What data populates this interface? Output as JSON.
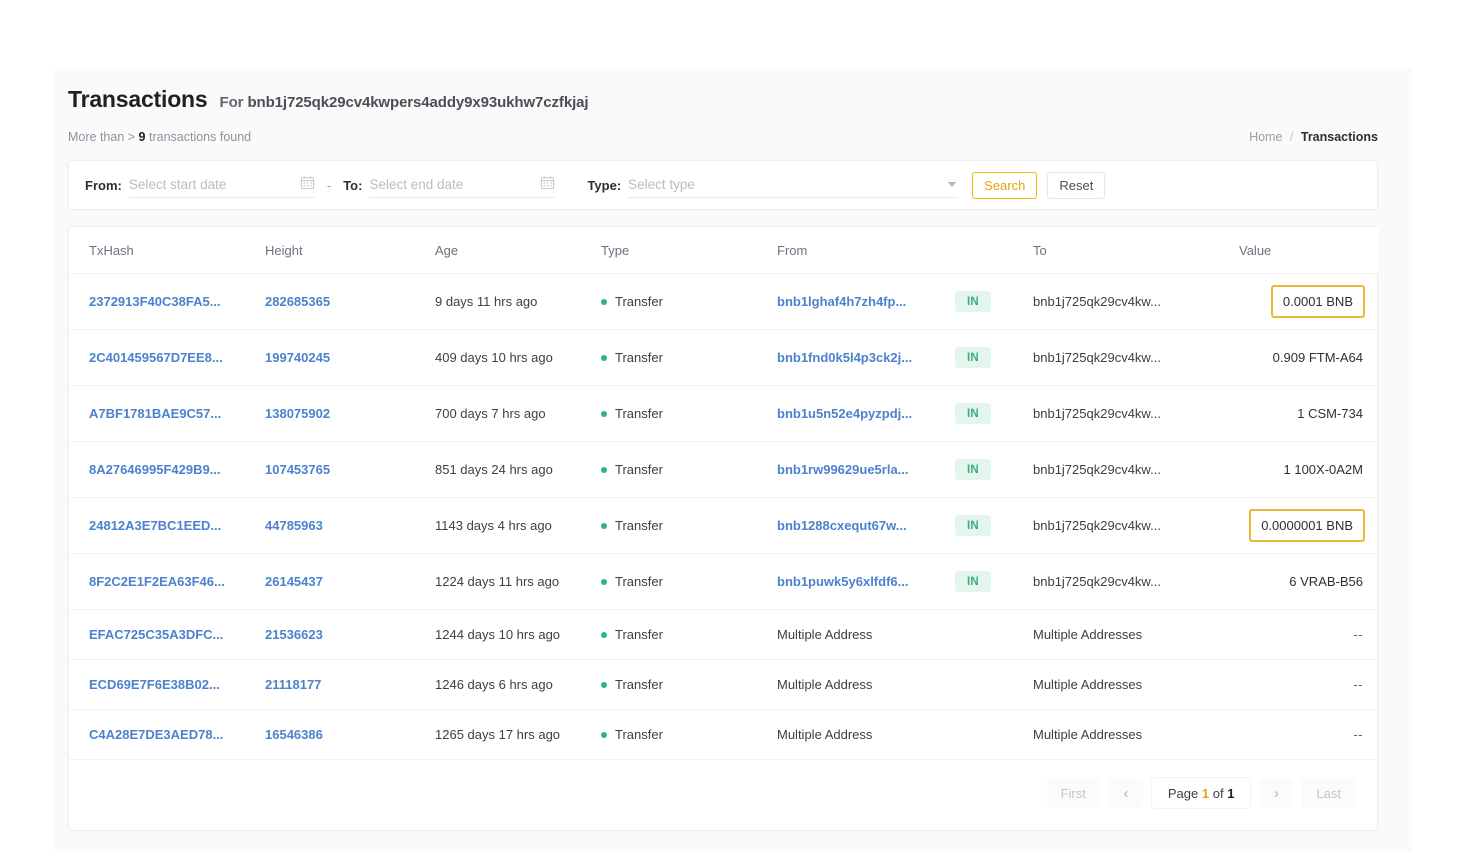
{
  "header": {
    "title": "Transactions",
    "for_label": "For",
    "address": "bnb1j725qk29cv4kwpers4addy9x93ukhw7czfkjaj",
    "found_prefix": "More than >",
    "found_count": "9",
    "found_suffix": "transactions found"
  },
  "breadcrumb": {
    "home": "Home",
    "separator": "/",
    "current": "Transactions"
  },
  "filters": {
    "from_label": "From:",
    "from_placeholder": "Select start date",
    "range_dash": "-",
    "to_label": "To:",
    "to_placeholder": "Select end date",
    "type_label": "Type:",
    "type_placeholder": "Select type",
    "search_button": "Search",
    "reset_button": "Reset",
    "search_accent_color": "#f0b90b"
  },
  "table": {
    "columns": [
      "TxHash",
      "Height",
      "Age",
      "Type",
      "From",
      "To",
      "Value"
    ],
    "rows": [
      {
        "txhash": "2372913F40C38FA5...",
        "height": "282685365",
        "age": "9 days 11 hrs ago",
        "type": "Transfer",
        "from": "bnb1lghaf4h7zh4fp...",
        "from_is_link": true,
        "direction": "IN",
        "to": "bnb1j725qk29cv4kw...",
        "value": "0.0001 BNB",
        "value_highlighted": true
      },
      {
        "txhash": "2C401459567D7EE8...",
        "height": "199740245",
        "age": "409 days 10 hrs ago",
        "type": "Transfer",
        "from": "bnb1fnd0k5l4p3ck2j...",
        "from_is_link": true,
        "direction": "IN",
        "to": "bnb1j725qk29cv4kw...",
        "value": "0.909 FTM-A64",
        "value_highlighted": false
      },
      {
        "txhash": "A7BF1781BAE9C57...",
        "height": "138075902",
        "age": "700 days 7 hrs ago",
        "type": "Transfer",
        "from": "bnb1u5n52e4pyzpdj...",
        "from_is_link": true,
        "direction": "IN",
        "to": "bnb1j725qk29cv4kw...",
        "value": "1 CSM-734",
        "value_highlighted": false
      },
      {
        "txhash": "8A27646995F429B9...",
        "height": "107453765",
        "age": "851 days 24 hrs ago",
        "type": "Transfer",
        "from": "bnb1rw99629ue5rla...",
        "from_is_link": true,
        "direction": "IN",
        "to": "bnb1j725qk29cv4kw...",
        "value": "1 100X-0A2M",
        "value_highlighted": false
      },
      {
        "txhash": "24812A3E7BC1EED...",
        "height": "44785963",
        "age": "1143 days 4 hrs ago",
        "type": "Transfer",
        "from": "bnb1288cxequt67w...",
        "from_is_link": true,
        "direction": "IN",
        "to": "bnb1j725qk29cv4kw...",
        "value": "0.0000001 BNB",
        "value_highlighted": true
      },
      {
        "txhash": "8F2C2E1F2EA63F46...",
        "height": "26145437",
        "age": "1224 days 11 hrs ago",
        "type": "Transfer",
        "from": "bnb1puwk5y6xlfdf6...",
        "from_is_link": true,
        "direction": "IN",
        "to": "bnb1j725qk29cv4kw...",
        "value": "6 VRAB-B56",
        "value_highlighted": false
      },
      {
        "txhash": "EFAC725C35A3DFC...",
        "height": "21536623",
        "age": "1244 days 10 hrs ago",
        "type": "Transfer",
        "from": "Multiple Address",
        "from_is_link": false,
        "direction": "",
        "to": "Multiple Addresses",
        "value": "--",
        "value_highlighted": false
      },
      {
        "txhash": "ECD69E7F6E38B02...",
        "height": "21118177",
        "age": "1246 days 6 hrs ago",
        "type": "Transfer",
        "from": "Multiple Address",
        "from_is_link": false,
        "direction": "",
        "to": "Multiple Addresses",
        "value": "--",
        "value_highlighted": false
      },
      {
        "txhash": "C4A28E7DE3AED78...",
        "height": "16546386",
        "age": "1265 days 17 hrs ago",
        "type": "Transfer",
        "from": "Multiple Address",
        "from_is_link": false,
        "direction": "",
        "to": "Multiple Addresses",
        "value": "--",
        "value_highlighted": false
      }
    ]
  },
  "pagination": {
    "first": "First",
    "prev": "‹",
    "page_word": "Page",
    "current_page": "1",
    "of_word": "of",
    "total_pages": "1",
    "next": "›",
    "last": "Last"
  },
  "colors": {
    "link": "#4c82cd",
    "accent_gold": "#f0b90b",
    "status_green": "#2cb67d",
    "badge_bg": "#e3f6ee",
    "highlight_border": "#eab737"
  }
}
